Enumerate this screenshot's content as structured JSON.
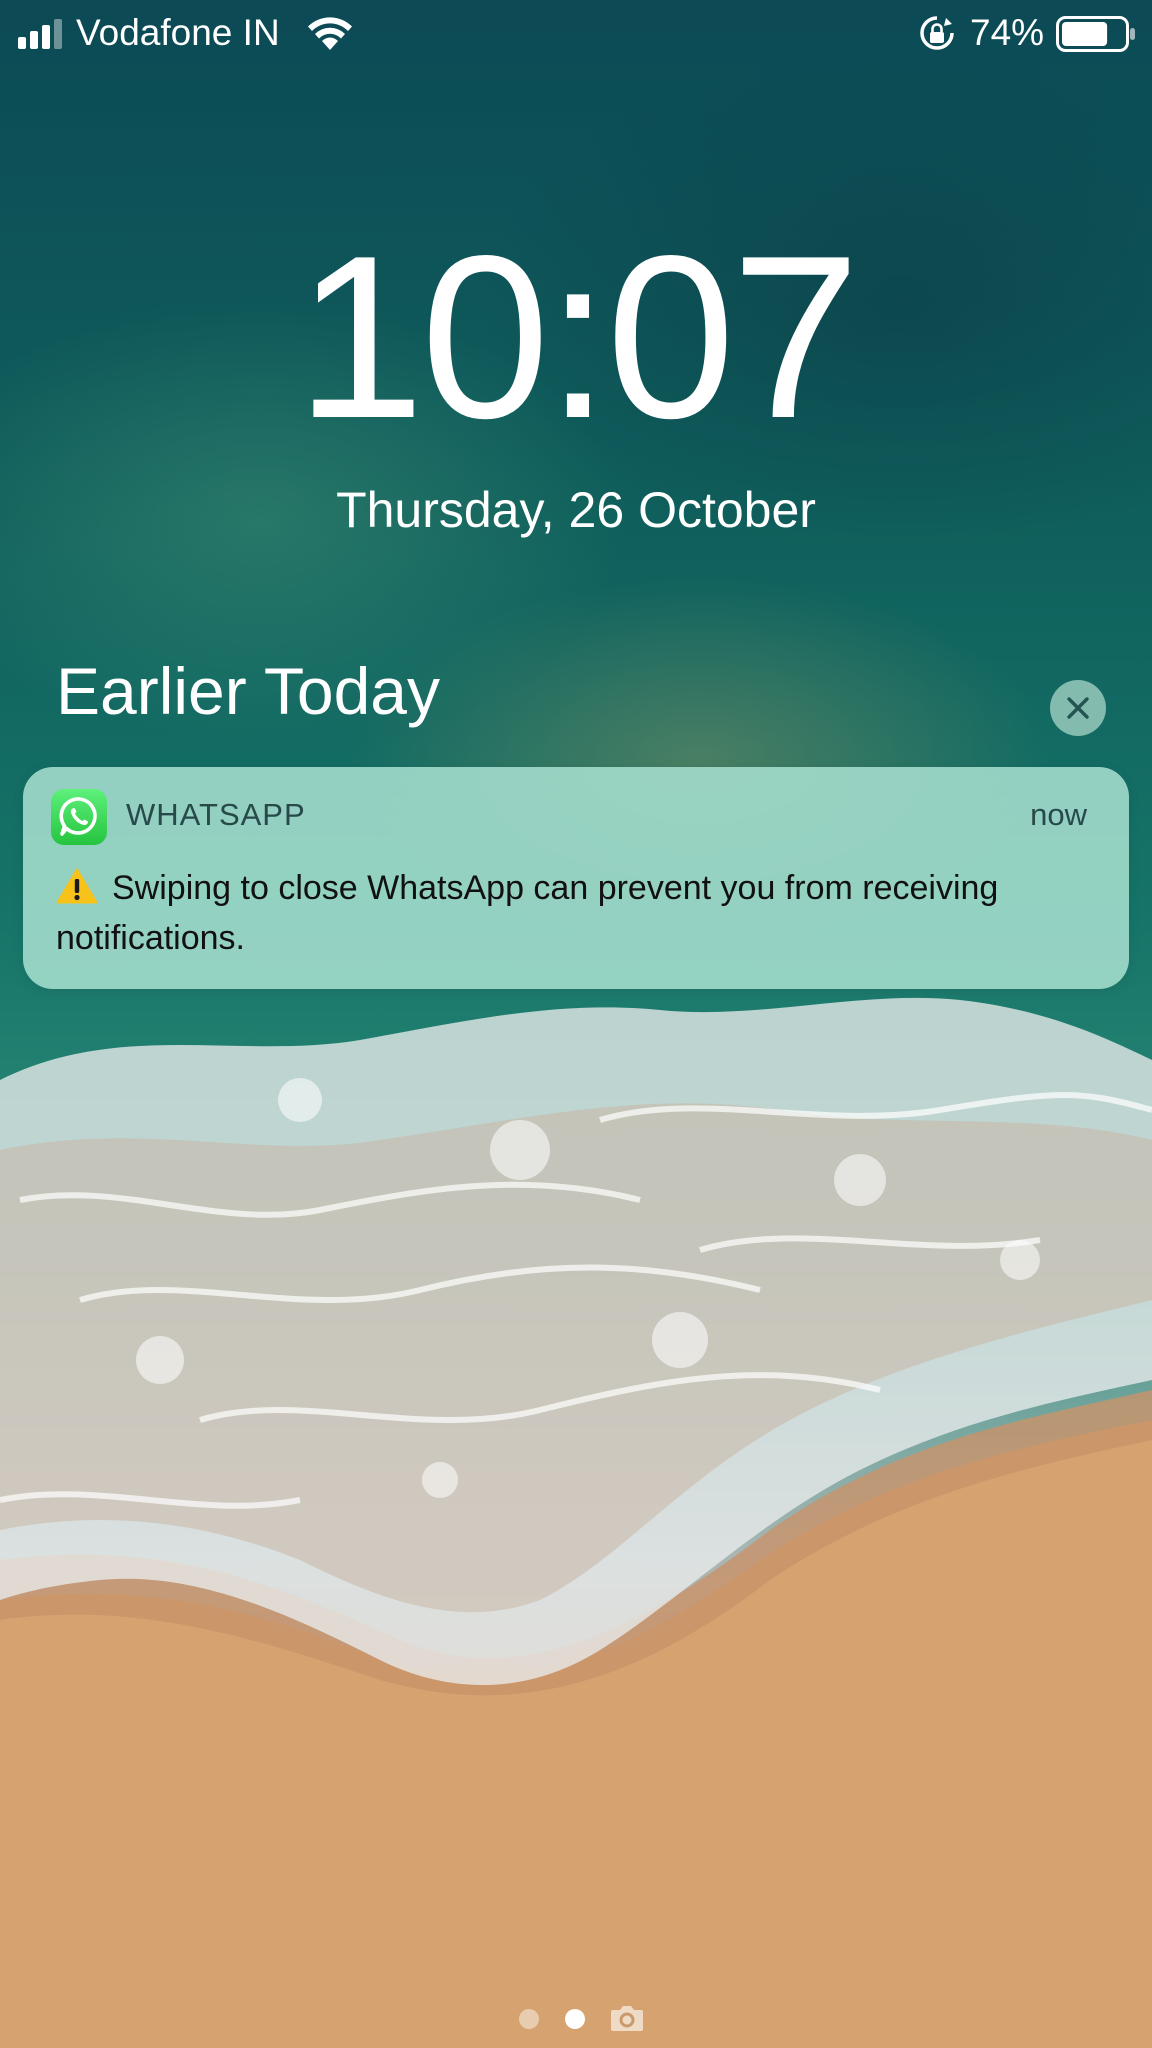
{
  "status_bar": {
    "carrier": "Vodafone IN",
    "battery_percent": "74%",
    "battery_level": 0.74,
    "signal_bars": 3,
    "icons": [
      "signal-icon",
      "wifi-icon",
      "rotation-lock-icon",
      "battery-icon"
    ]
  },
  "lock_screen": {
    "time": "10:07",
    "date": "Thursday, 26 October"
  },
  "notifications": {
    "section_title": "Earlier Today",
    "clear_icon": "close-icon",
    "items": [
      {
        "app_name": "WHATSAPP",
        "app_icon": "whatsapp-icon",
        "time": "now",
        "body_icon": "warning-icon",
        "body": "Swiping to close WhatsApp can prevent you from receiving notifications."
      }
    ]
  },
  "page_indicator": {
    "pages": 3,
    "current_page": 2,
    "last_icon": "camera-icon"
  },
  "colors": {
    "notification_bg": "#a5dece",
    "app_icon_green": "#25c43f",
    "text_dark": "#111111"
  }
}
